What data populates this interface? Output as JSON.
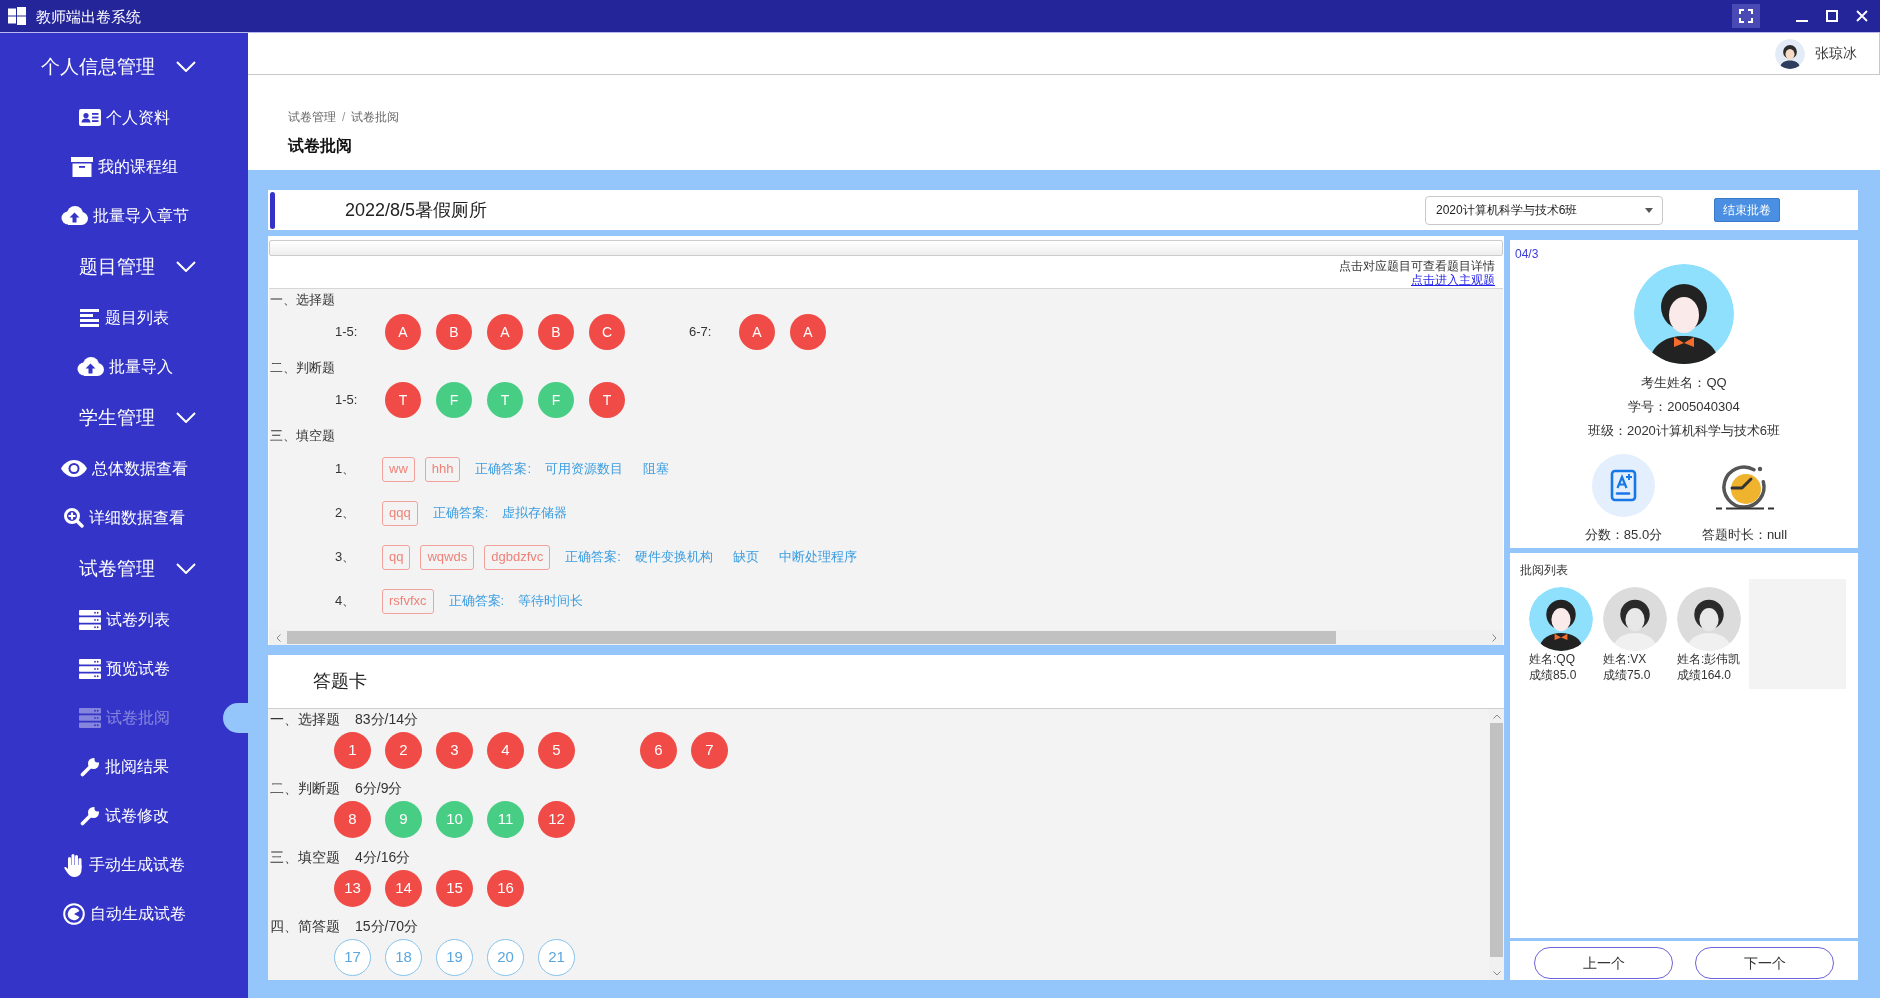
{
  "window": {
    "title": "教师端出卷系统"
  },
  "sidebar": {
    "groups": [
      {
        "label": "个人信息管理",
        "expanded": true,
        "items": [
          {
            "label": "个人资料",
            "selected": false
          },
          {
            "label": "我的课程组",
            "selected": false
          },
          {
            "label": "批量导入章节",
            "selected": false
          }
        ]
      },
      {
        "label": "题目管理",
        "expanded": true,
        "items": [
          {
            "label": "题目列表",
            "selected": false
          },
          {
            "label": "批量导入",
            "selected": false
          }
        ]
      },
      {
        "label": "学生管理",
        "expanded": true,
        "items": [
          {
            "label": "总体数据查看",
            "selected": false
          },
          {
            "label": "详细数据查看",
            "selected": false
          }
        ]
      },
      {
        "label": "试卷管理",
        "expanded": true,
        "items": [
          {
            "label": "试卷列表",
            "selected": false
          },
          {
            "label": "预览试卷",
            "selected": false
          },
          {
            "label": "试卷批阅",
            "selected": true
          },
          {
            "label": "批阅结果",
            "selected": false
          },
          {
            "label": "试卷修改",
            "selected": false
          },
          {
            "label": "手动生成试卷",
            "selected": false
          },
          {
            "label": "自动生成试卷",
            "selected": false
          }
        ]
      }
    ]
  },
  "header": {
    "user_name": "张琼冰"
  },
  "breadcrumb": {
    "items": [
      "试卷管理",
      "试卷批阅"
    ],
    "separator": "/"
  },
  "page_title": "试卷批阅",
  "exam": {
    "title": "2022/8/5暑假厕所",
    "class_select": "2020计算机科学与技术6班",
    "finish_button": "结束批卷"
  },
  "questions": {
    "hint": "点击对应题目可查看题目详情",
    "subjective_link": "点击进入主观题",
    "sections": [
      {
        "kind": "choice",
        "title": "一、选择题",
        "groups": [
          {
            "range": "1-5:",
            "answers": [
              {
                "text": "A",
                "correct": false
              },
              {
                "text": "B",
                "correct": false
              },
              {
                "text": "A",
                "correct": false
              },
              {
                "text": "B",
                "correct": false
              },
              {
                "text": "C",
                "correct": false
              }
            ]
          },
          {
            "range": "6-7:",
            "answers": [
              {
                "text": "A",
                "correct": false
              },
              {
                "text": "A",
                "correct": false
              }
            ]
          }
        ]
      },
      {
        "kind": "choice",
        "title": "二、判断题",
        "groups": [
          {
            "range": "1-5:",
            "answers": [
              {
                "text": "T",
                "correct": false
              },
              {
                "text": "F",
                "correct": true
              },
              {
                "text": "T",
                "correct": true
              },
              {
                "text": "F",
                "correct": true
              },
              {
                "text": "T",
                "correct": false
              }
            ]
          }
        ]
      },
      {
        "kind": "blank",
        "title": "三、填空题",
        "items": [
          {
            "number": "1、",
            "answers": [
              {
                "text": "ww",
                "correct": false
              },
              {
                "text": "hhh",
                "correct": false
              }
            ],
            "key_label": "正确答案:",
            "key": [
              "可用资源数目",
              "阻塞"
            ]
          },
          {
            "number": "2、",
            "answers": [
              {
                "text": "qqq",
                "correct": false
              }
            ],
            "key_label": "正确答案:",
            "key": [
              "虚拟存储器"
            ]
          },
          {
            "number": "3、",
            "answers": [
              {
                "text": "qq",
                "correct": false
              },
              {
                "text": "wqwds",
                "correct": false
              },
              {
                "text": "dgbdzfvc",
                "correct": false
              }
            ],
            "key_label": "正确答案:",
            "key": [
              "硬件变换机构",
              "缺页",
              "中断处理程序"
            ]
          },
          {
            "number": "4、",
            "answers": [
              {
                "text": "rsfvfxc",
                "correct": false
              }
            ],
            "key_label": "正确答案:",
            "key": [
              "等待时间长"
            ]
          }
        ]
      }
    ]
  },
  "answer_card": {
    "title": "答题卡",
    "sections": [
      {
        "title": "一、选择题",
        "score": "83分/14分",
        "groups": [
          {
            "questions": [
              {
                "number": "1",
                "graded": true,
                "correct": false
              },
              {
                "number": "2",
                "graded": true,
                "correct": false
              },
              {
                "number": "3",
                "graded": true,
                "correct": false
              },
              {
                "number": "4",
                "graded": true,
                "correct": false
              },
              {
                "number": "5",
                "graded": true,
                "correct": false
              }
            ]
          },
          {
            "questions": [
              {
                "number": "6",
                "graded": true,
                "correct": false
              },
              {
                "number": "7",
                "graded": true,
                "correct": false
              }
            ]
          }
        ]
      },
      {
        "title": "二、判断题",
        "score": "6分/9分",
        "groups": [
          {
            "questions": [
              {
                "number": "8",
                "graded": true,
                "correct": false
              },
              {
                "number": "9",
                "graded": true,
                "correct": true
              },
              {
                "number": "10",
                "graded": true,
                "correct": true
              },
              {
                "number": "11",
                "graded": true,
                "correct": true
              },
              {
                "number": "12",
                "graded": true,
                "correct": false
              }
            ]
          }
        ]
      },
      {
        "title": "三、填空题",
        "score": "4分/16分",
        "groups": [
          {
            "questions": [
              {
                "number": "13",
                "graded": true,
                "correct": false
              },
              {
                "number": "14",
                "graded": true,
                "correct": false
              },
              {
                "number": "15",
                "graded": true,
                "correct": false
              },
              {
                "number": "16",
                "graded": true,
                "correct": false
              }
            ]
          }
        ]
      },
      {
        "title": "四、简答题",
        "score": "15分/70分",
        "groups": [
          {
            "questions": [
              {
                "number": "17",
                "graded": false
              },
              {
                "number": "18",
                "graded": false
              },
              {
                "number": "19",
                "graded": false
              },
              {
                "number": "20",
                "graded": false
              },
              {
                "number": "21",
                "graded": false
              }
            ]
          }
        ]
      }
    ]
  },
  "student_panel": {
    "counter": "04/3",
    "name": "考生姓名：QQ",
    "number": "学号：2005040304",
    "class": "班级：2020计算机科学与技术6班",
    "score": "分数：85.0分",
    "duration": "答题时长：null"
  },
  "review_list": {
    "title": "批阅列表",
    "students": [
      {
        "name": "姓名:QQ",
        "score": "成绩85.0",
        "selected": true
      },
      {
        "name": "姓名:VX",
        "score": "成绩75.0",
        "selected": false
      },
      {
        "name": "姓名:彭伟凯",
        "score": "成绩164.0",
        "selected": false
      }
    ]
  },
  "nav_buttons": [
    "上一个",
    "下一个"
  ]
}
